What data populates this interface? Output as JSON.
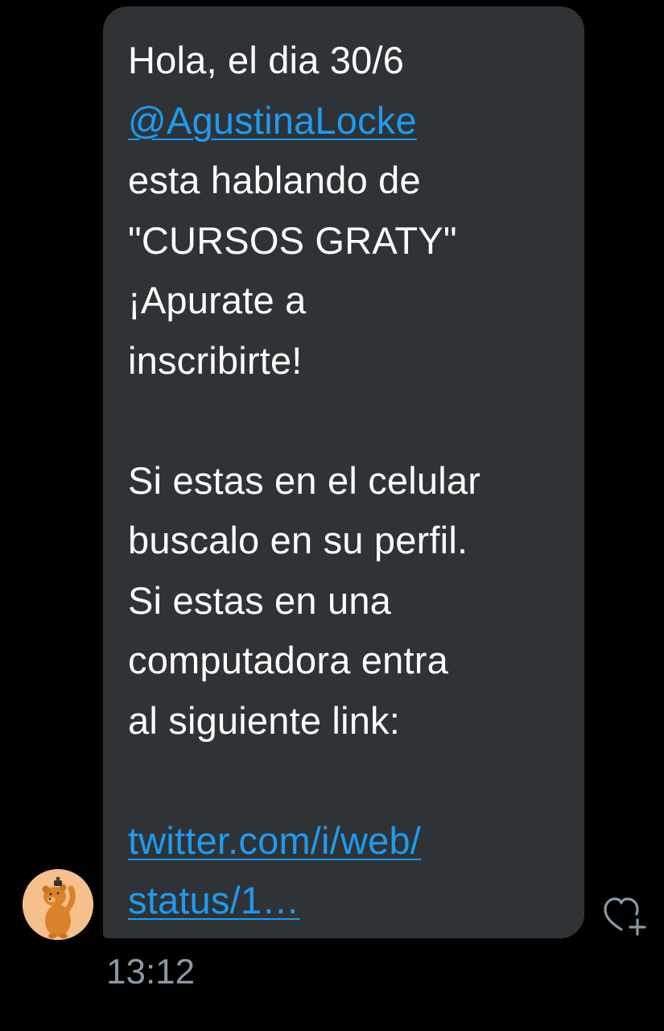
{
  "message": {
    "lines": [
      "Hola, el dia 30/6",
      "@AgustinaLocke",
      "esta hablando de",
      "\"CURSOS GRATY\"",
      "¡Apurate a",
      "inscribirte!",
      "",
      "Si estas en el celular",
      "buscalo en su perfil.",
      "Si estas en una",
      "computadora entra",
      "al siguiente link:",
      "",
      "twitter.com/i/web/",
      "status/1…"
    ],
    "timestamp": "13:12"
  },
  "sender": {
    "avatar_icon": "bear-avatar-icon"
  },
  "actions": {
    "like_icon": "heart-plus-icon"
  },
  "colors": {
    "background": "#000000",
    "bubble": "#2f3336",
    "text": "#ffffff",
    "link": "#1d9bf0",
    "timestamp": "#8b98a5",
    "avatar_bg": "#f6c08d"
  }
}
